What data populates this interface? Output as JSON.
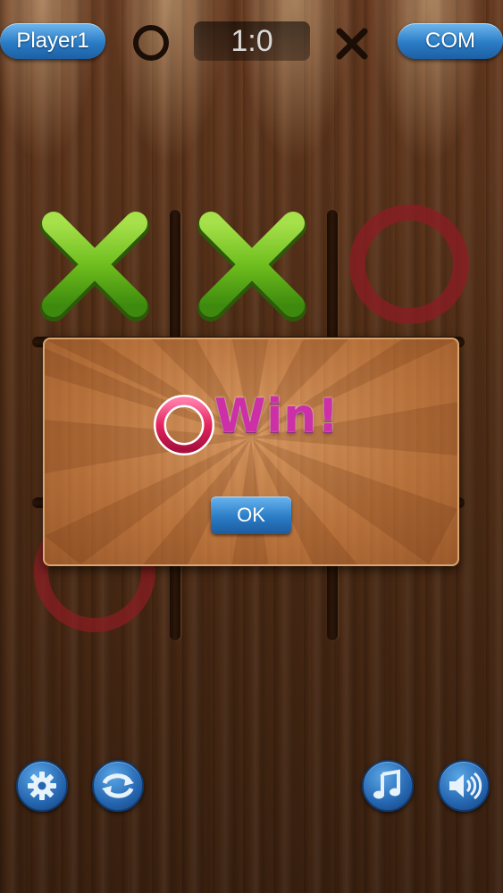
{
  "header": {
    "player1_label": "Player1",
    "score": "1:0",
    "com_label": "COM",
    "player1_symbol": "circle-icon",
    "com_symbol": "cross-icon"
  },
  "board": {
    "cells": [
      "X",
      "X",
      "O",
      "",
      "",
      "",
      "O",
      "",
      ""
    ],
    "x_color": "#6fbf1e",
    "o_color": "#b2232b"
  },
  "dialog": {
    "winner_symbol": "O",
    "win_text": "Win!",
    "ok_label": "OK",
    "win_color": "#cc2fa6"
  },
  "footer": {
    "buttons": [
      "gear-icon",
      "restart-icon",
      "music-icon",
      "sound-icon"
    ]
  }
}
